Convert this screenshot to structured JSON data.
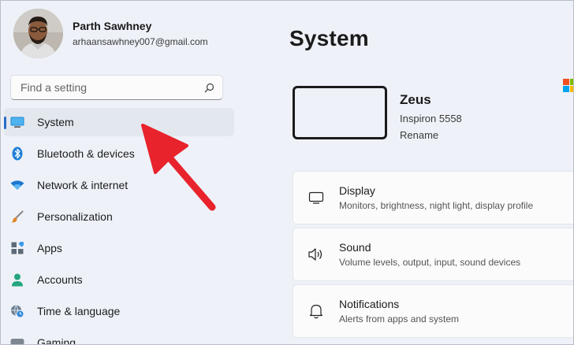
{
  "profile": {
    "name": "Parth Sawhney",
    "email": "arhaansawhney007@gmail.com"
  },
  "search": {
    "placeholder": "Find a setting",
    "icon": "search-icon"
  },
  "sidebar": {
    "items": [
      {
        "label": "System",
        "icon": "monitor-icon",
        "active": true
      },
      {
        "label": "Bluetooth & devices",
        "icon": "bluetooth-icon"
      },
      {
        "label": "Network & internet",
        "icon": "wifi-icon"
      },
      {
        "label": "Personalization",
        "icon": "brush-icon"
      },
      {
        "label": "Apps",
        "icon": "apps-icon"
      },
      {
        "label": "Accounts",
        "icon": "person-icon"
      },
      {
        "label": "Time & language",
        "icon": "globe-clock-icon"
      },
      {
        "label": "Gaming",
        "icon": "gamepad-icon"
      }
    ]
  },
  "main": {
    "title": "System",
    "device": {
      "name": "Zeus",
      "model": "Inspiron 5558",
      "rename_label": "Rename"
    },
    "settings": [
      {
        "title": "Display",
        "desc": "Monitors, brightness, night light, display profile",
        "icon": "display-icon"
      },
      {
        "title": "Sound",
        "desc": "Volume levels, output, input, sound devices",
        "icon": "speaker-icon"
      },
      {
        "title": "Notifications",
        "desc": "Alerts from apps and system",
        "icon": "bell-icon"
      }
    ]
  },
  "colors": {
    "accent": "#2b6acb",
    "arrow": "#e8232c",
    "background": "#eef2f8"
  }
}
